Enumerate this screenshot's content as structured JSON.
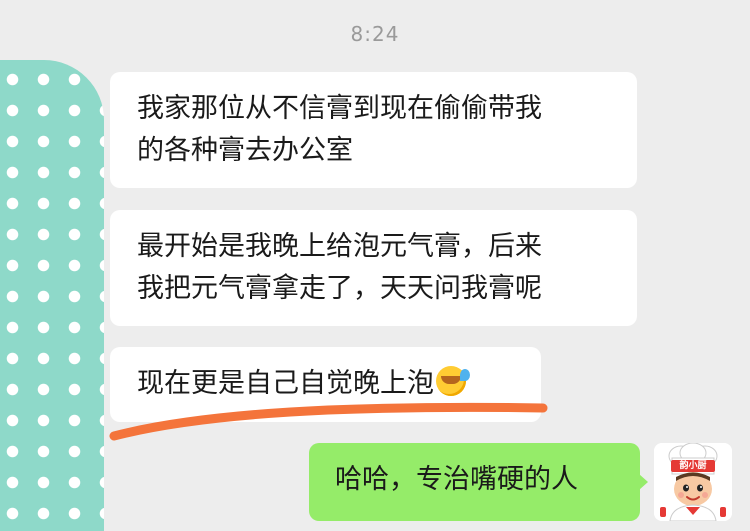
{
  "status": {
    "time": "8:24"
  },
  "chat": {
    "left_avatar": {
      "icon": "polka-dot-avatar-icon",
      "colors": {
        "base": "#8ed9c9",
        "dots": "#ffffff"
      }
    },
    "messages": [
      {
        "side": "left",
        "lines": [
          "我家那位从不信膏到现在偷偷带我",
          "的各种膏去办公室"
        ]
      },
      {
        "side": "left",
        "lines": [
          "最开始是我晚上给泡元气膏，后来",
          "我把元气膏拿走了，天天问我膏呢"
        ]
      },
      {
        "side": "left",
        "lines": [
          "现在更是自己自觉晚上泡"
        ],
        "emoji": "crying-laughing-emoji-icon",
        "highlight_color": "#f4743b"
      },
      {
        "side": "right",
        "lines": [
          "哈哈，专治嘴硬的人"
        ]
      }
    ],
    "right_avatar": {
      "icon": "chef-avatar-icon",
      "badge_text": "韵小厨"
    }
  },
  "colors": {
    "background": "#ededed",
    "bubble_left": "#ffffff",
    "bubble_right": "#95ec69",
    "time": "#9a9a9a"
  }
}
